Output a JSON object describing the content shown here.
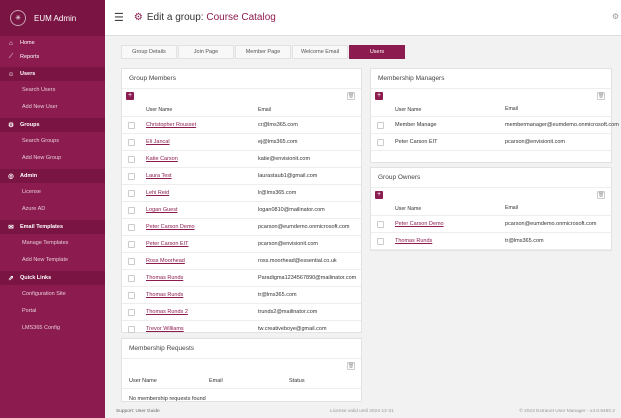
{
  "app": {
    "name": "EUM Admin"
  },
  "header": {
    "title_prefix": "Edit a group:",
    "group_name": "Course Catalog"
  },
  "sidebar": {
    "items": [
      {
        "label": "Home",
        "type": "item",
        "icon": "home-icon"
      },
      {
        "label": "Reports",
        "type": "item",
        "icon": "chart-icon"
      },
      {
        "label": "Users",
        "type": "section",
        "icon": "users-icon"
      },
      {
        "label": "Search Users",
        "type": "sub"
      },
      {
        "label": "Add New User",
        "type": "sub"
      },
      {
        "label": "Groups",
        "type": "section",
        "icon": "groups-icon"
      },
      {
        "label": "Search Groups",
        "type": "sub"
      },
      {
        "label": "Add New Group",
        "type": "sub"
      },
      {
        "label": "Admin",
        "type": "section",
        "icon": "admin-icon"
      },
      {
        "label": "License",
        "type": "sub"
      },
      {
        "label": "Azure AD",
        "type": "sub"
      },
      {
        "label": "Email Templates",
        "type": "section",
        "icon": "email-icon"
      },
      {
        "label": "Manage Templates",
        "type": "sub"
      },
      {
        "label": "Add New Template",
        "type": "sub"
      },
      {
        "label": "Quick Links",
        "type": "section",
        "icon": "link-icon"
      },
      {
        "label": "Configuration Site",
        "type": "sub"
      },
      {
        "label": "Portal",
        "type": "sub"
      },
      {
        "label": "LMS365 Config",
        "type": "sub"
      }
    ]
  },
  "tabs": [
    {
      "label": "Group Details",
      "active": false
    },
    {
      "label": "Join Page",
      "active": false
    },
    {
      "label": "Member Page",
      "active": false
    },
    {
      "label": "Welcome Email",
      "active": false
    },
    {
      "label": "Users",
      "active": true
    }
  ],
  "group_members": {
    "title": "Group Members",
    "col_user": "User Name",
    "col_email": "Email",
    "rows": [
      {
        "name": "Christopher Rousset",
        "email": "cr@lms365.com"
      },
      {
        "name": "Eli Jancal",
        "email": "ej@lms365.com"
      },
      {
        "name": "Katie Carson",
        "email": "katie@envisionit.com"
      },
      {
        "name": "Laura Test",
        "email": "laurastaub1@gmail.com"
      },
      {
        "name": "Lehi Reid",
        "email": "lr@lms365.com"
      },
      {
        "name": "Logan Guest",
        "email": "logan0810@mailinator.com"
      },
      {
        "name": "Peter Carson Demo",
        "email": "pcarson@eumdemo.onmicrosoft.com"
      },
      {
        "name": "Peter Carson EIT",
        "email": "pcarson@envisionit.com"
      },
      {
        "name": "Ross Moorhead",
        "email": "ross.moorhead@essential.co.uk"
      },
      {
        "name": "Thomas Runds",
        "email": "Paradigma1234567890@mailinator.com"
      },
      {
        "name": "Thomas Runds",
        "email": "tr@lms365.com"
      },
      {
        "name": "Thomas Runds 2",
        "email": "trunds2@mailinator.com"
      },
      {
        "name": "Trevor Williams",
        "email": "tw.creativeboye@gmail.com"
      }
    ]
  },
  "membership_requests": {
    "title": "Membership Requests",
    "col_user": "User Name",
    "col_email": "Email",
    "col_status": "Status",
    "empty": "No membership requests found"
  },
  "membership_managers": {
    "title": "Membership Managers",
    "col_user": "User Name",
    "col_email": "Email",
    "rows": [
      {
        "name": "Member Manage",
        "email": "membermanager@eumdemo.onmicrosoft.com",
        "link": false
      },
      {
        "name": "Peter Carson EIT",
        "email": "pcarson@envisionit.com",
        "link": false
      }
    ]
  },
  "group_owners": {
    "title": "Group Owners",
    "col_user": "User Name",
    "col_email": "Email",
    "rows": [
      {
        "name": "Peter Carson Demo",
        "email": "pcarson@eumdemo.onmicrosoft.com",
        "link": true
      },
      {
        "name": "Thomas Runds",
        "email": "tr@lms365.com",
        "link": true
      }
    ]
  },
  "footer": {
    "support": "Support: User Guide",
    "license": "License valid until 2024-12-31",
    "copyright": "© 2023 Extranet User Manager - v4.0.6460.2"
  },
  "colors": {
    "brand": "#8c1b4f",
    "brand_dark": "#7a1443"
  }
}
